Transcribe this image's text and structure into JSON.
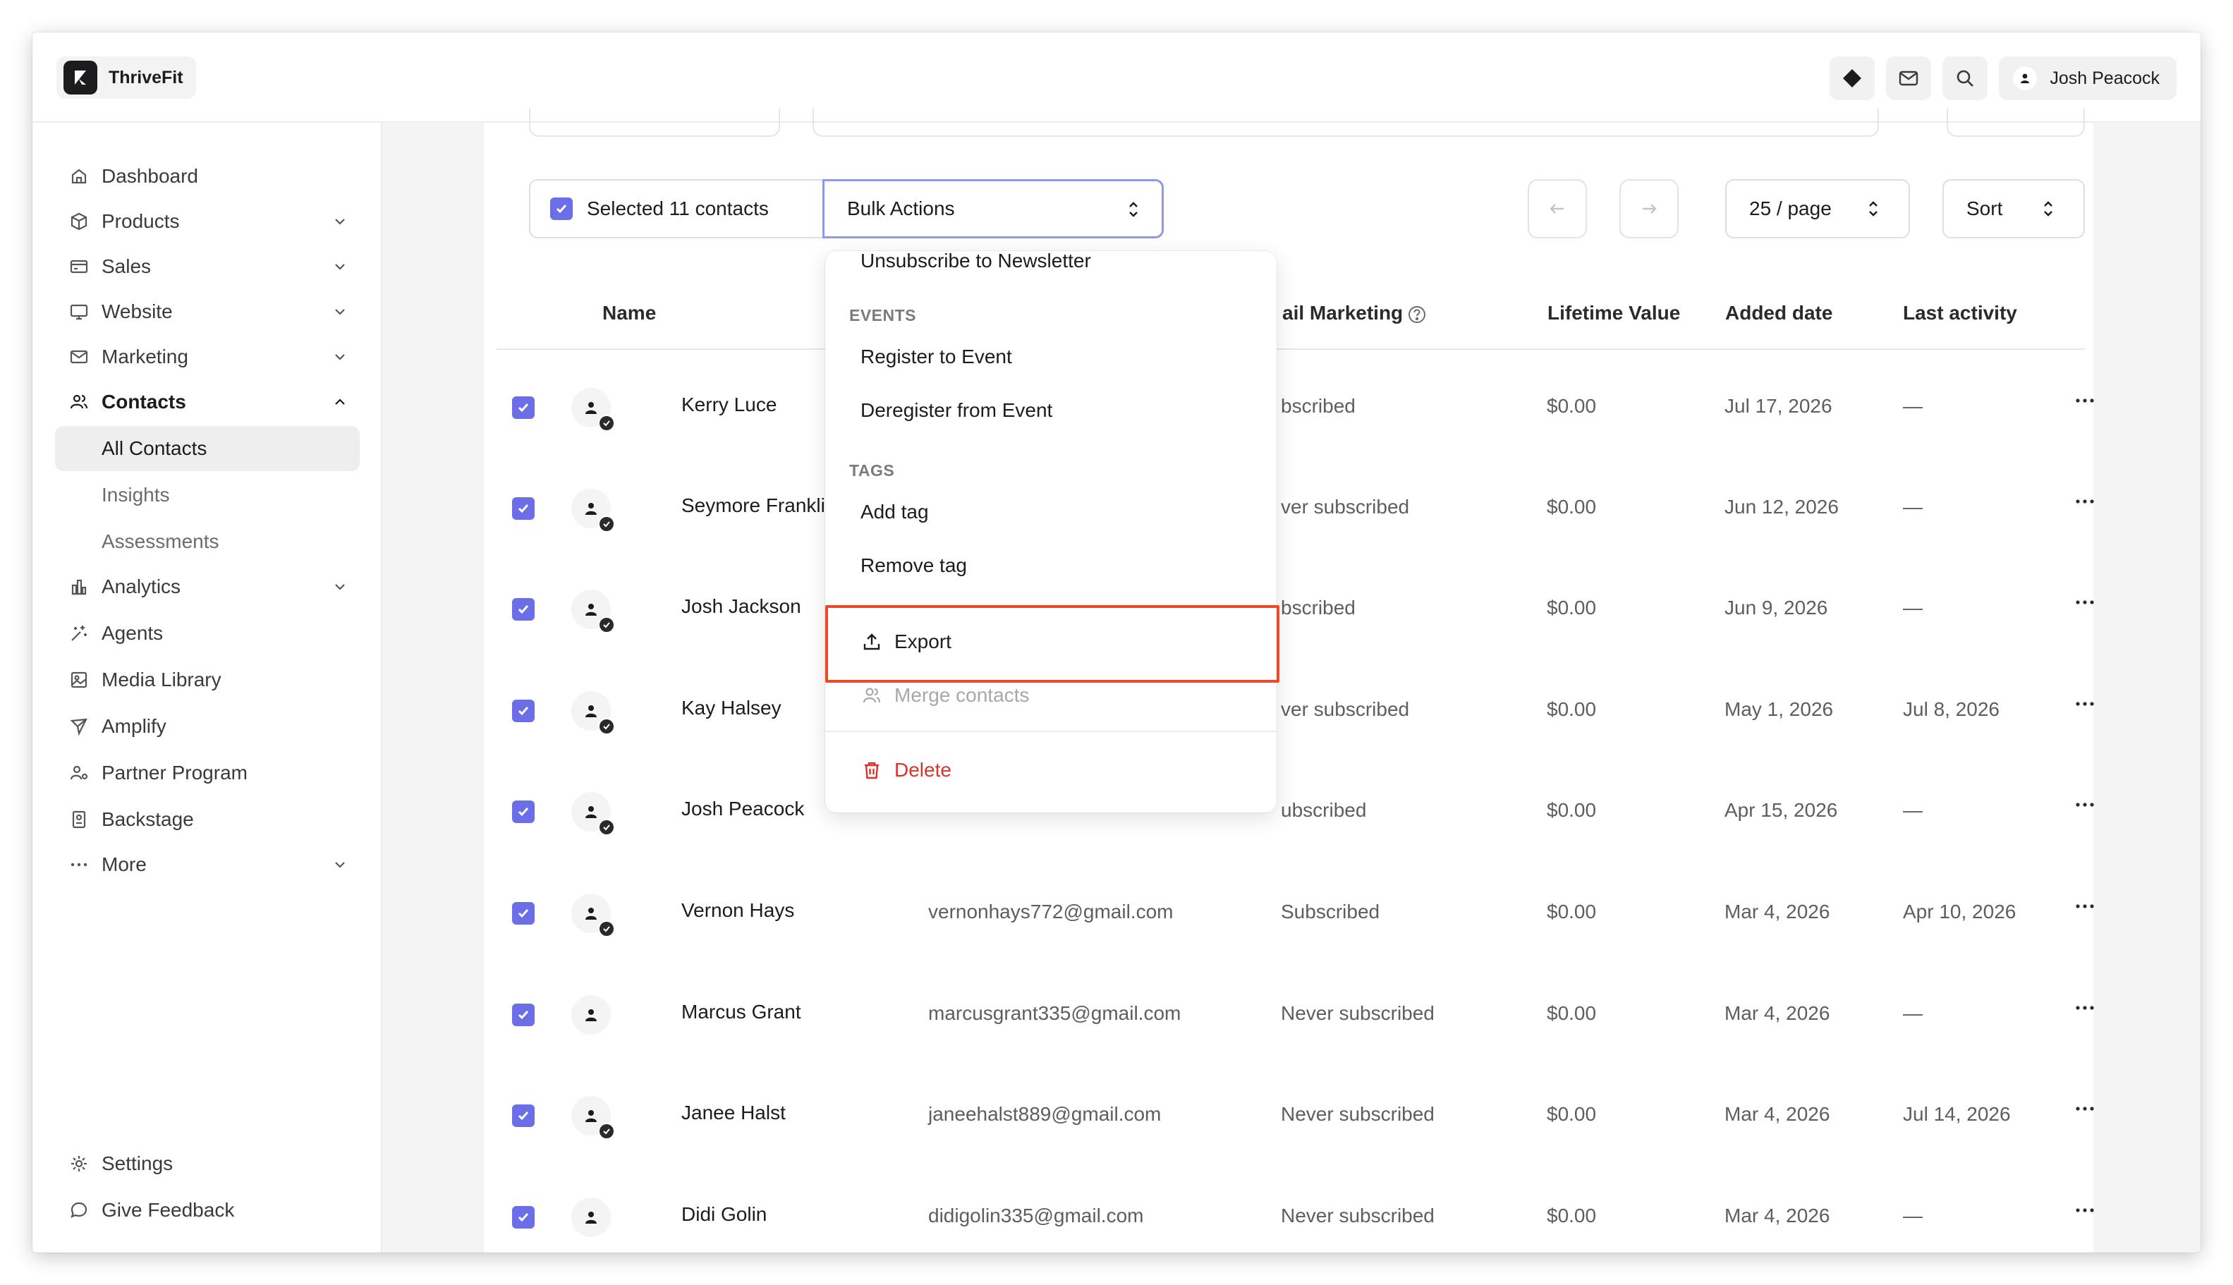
{
  "app": {
    "name": "ThriveFit"
  },
  "topbar": {
    "user_name": "Josh Peacock",
    "icons": [
      "diamond-icon",
      "mail-icon",
      "search-icon",
      "user-icon"
    ]
  },
  "sidebar": {
    "items": [
      {
        "label": "Dashboard",
        "icon": "home-icon"
      },
      {
        "label": "Products",
        "icon": "box-icon",
        "expandable": true
      },
      {
        "label": "Sales",
        "icon": "card-icon",
        "expandable": true
      },
      {
        "label": "Website",
        "icon": "monitor-icon",
        "expandable": true
      },
      {
        "label": "Marketing",
        "icon": "mail-icon",
        "expandable": true
      },
      {
        "label": "Contacts",
        "icon": "contacts-icon",
        "expanded": true
      },
      {
        "label": "All Contacts",
        "active": true
      },
      {
        "label": "Insights"
      },
      {
        "label": "Assessments"
      },
      {
        "label": "Analytics",
        "icon": "chart-icon",
        "expandable": true
      },
      {
        "label": "Agents",
        "icon": "sparkle-icon"
      },
      {
        "label": "Media Library",
        "icon": "image-icon"
      },
      {
        "label": "Amplify",
        "icon": "megaphone-icon"
      },
      {
        "label": "Partner Program",
        "icon": "partner-icon"
      },
      {
        "label": "Backstage",
        "icon": "badge-icon"
      },
      {
        "label": "More",
        "icon": "dots-icon",
        "expandable": true
      }
    ],
    "footer": [
      {
        "label": "Settings",
        "icon": "gear-icon"
      },
      {
        "label": "Give Feedback",
        "icon": "chat-icon"
      }
    ]
  },
  "toolbar": {
    "selected_label": "Selected 11 contacts",
    "bulk_actions_label": "Bulk Actions",
    "per_page_label": "25 / page",
    "sort_label": "Sort"
  },
  "table": {
    "columns": [
      "Name",
      "ail Marketing",
      "Lifetime Value",
      "Added date",
      "Last activity"
    ],
    "rows": [
      {
        "name": "Kerry Luce",
        "email": "",
        "status": "bscribed",
        "value": "$0.00",
        "added": "Jul 17, 2026",
        "activity": "—",
        "badge": true
      },
      {
        "name": "Seymore Franklin",
        "email": "",
        "status": "ver subscribed",
        "value": "$0.00",
        "added": "Jun 12, 2026",
        "activity": "—",
        "badge": true
      },
      {
        "name": "Josh Jackson",
        "email": "",
        "status": "bscribed",
        "value": "$0.00",
        "added": "Jun 9, 2026",
        "activity": "—",
        "badge": true
      },
      {
        "name": "Kay Halsey",
        "email": "",
        "status": "ver subscribed",
        "value": "$0.00",
        "added": "May 1, 2026",
        "activity": "Jul 8, 2026",
        "badge": true
      },
      {
        "name": "Josh Peacock",
        "email": "",
        "status": "ubscribed",
        "value": "$0.00",
        "added": "Apr 15, 2026",
        "activity": "—",
        "badge": true
      },
      {
        "name": "Vernon Hays",
        "email": "vernonhays772@gmail.com",
        "status": "Subscribed",
        "value": "$0.00",
        "added": "Mar 4, 2026",
        "activity": "Apr 10, 2026",
        "badge": true
      },
      {
        "name": "Marcus Grant",
        "email": "marcusgrant335@gmail.com",
        "status": "Never subscribed",
        "value": "$0.00",
        "added": "Mar 4, 2026",
        "activity": "—",
        "badge": false
      },
      {
        "name": "Janee Halst",
        "email": "janeehalst889@gmail.com",
        "status": "Never subscribed",
        "value": "$0.00",
        "added": "Mar 4, 2026",
        "activity": "Jul 14, 2026",
        "badge": true
      },
      {
        "name": "Didi Golin",
        "email": "didigolin335@gmail.com",
        "status": "Never subscribed",
        "value": "$0.00",
        "added": "Mar 4, 2026",
        "activity": "—",
        "badge": false
      }
    ]
  },
  "dropdown": {
    "partial_item": "Unsubscribe to Newsletter",
    "events_heading": "EVENTS",
    "register_event": "Register to Event",
    "deregister_event": "Deregister from Event",
    "tags_heading": "TAGS",
    "add_tag": "Add tag",
    "remove_tag": "Remove tag",
    "export": "Export",
    "merge_contacts": "Merge contacts",
    "delete": "Delete"
  },
  "colors": {
    "accent": "#6c6ee8",
    "highlight": "#ef4a23",
    "danger": "#d9342b"
  }
}
